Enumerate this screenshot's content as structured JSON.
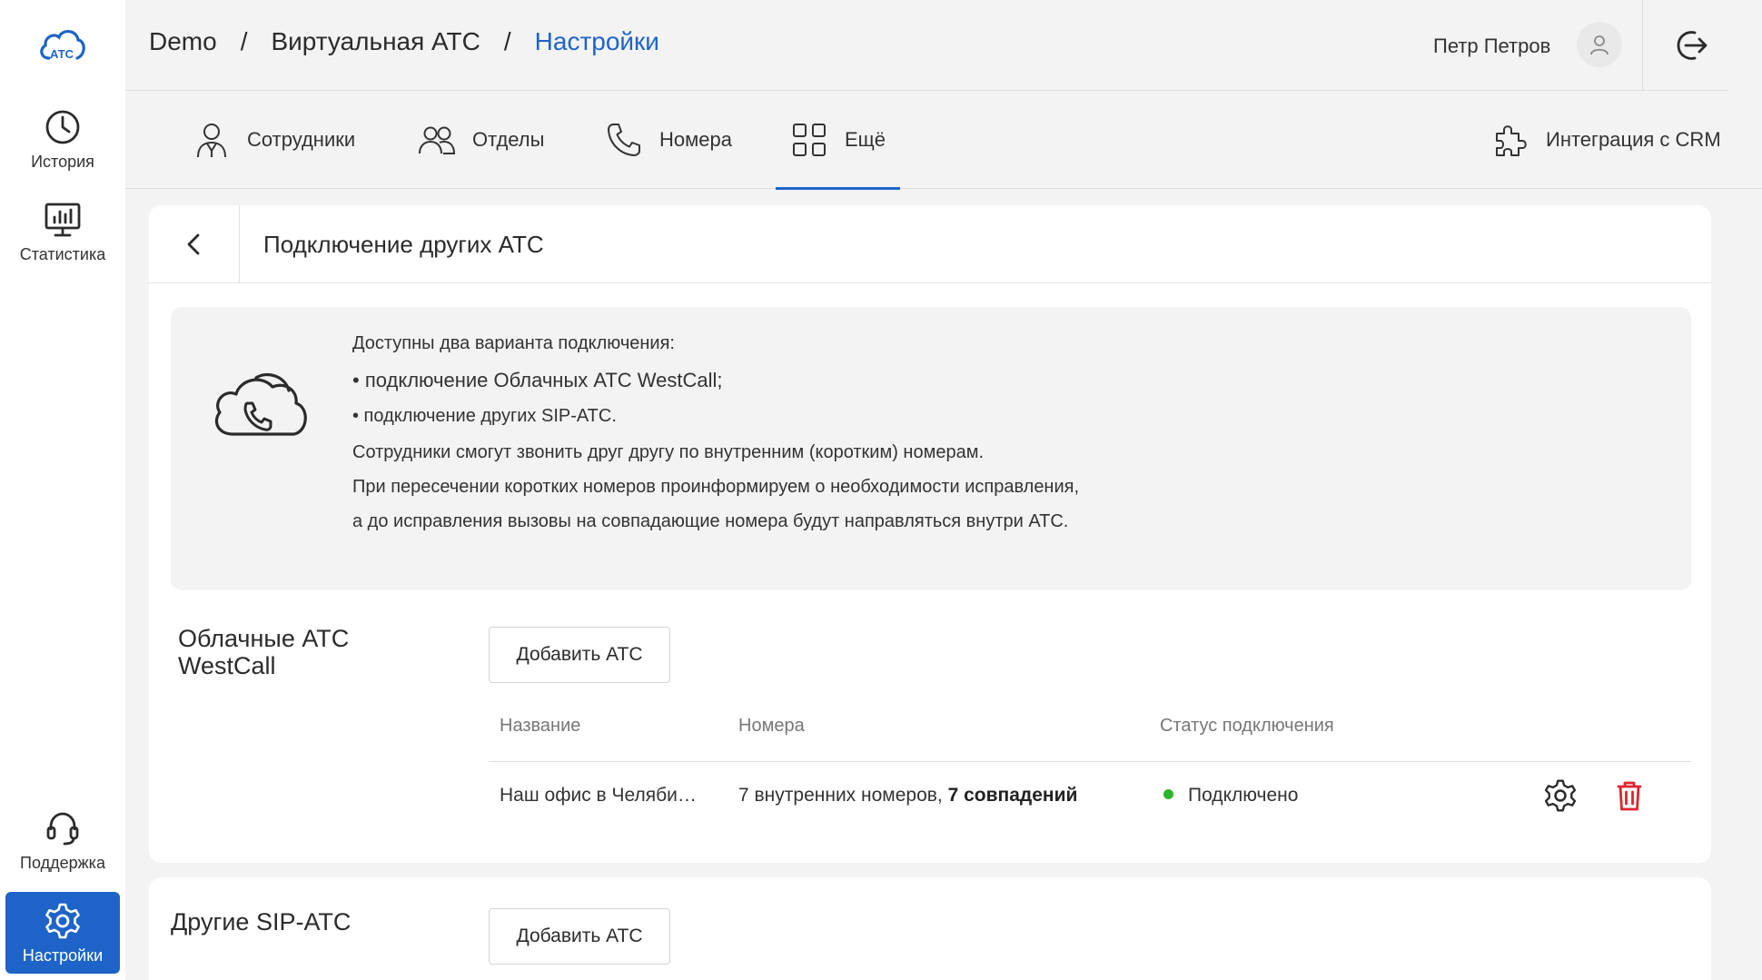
{
  "sidebar": {
    "logo_text": "АТС",
    "items": [
      {
        "label": "История",
        "icon": "clock-icon"
      },
      {
        "label": "Статистика",
        "icon": "monitor-chart-icon"
      },
      {
        "label": "Поддержка",
        "icon": "headset-icon"
      },
      {
        "label": "Настройки",
        "icon": "gear-icon",
        "active": true
      }
    ]
  },
  "header": {
    "breadcrumb": [
      "Demo",
      "Виртуальная АТС",
      "Настройки"
    ],
    "separator": "/",
    "user_name": "Петр Петров"
  },
  "tabs": [
    {
      "label": "Сотрудники",
      "icon": "person-icon"
    },
    {
      "label": "Отделы",
      "icon": "group-icon"
    },
    {
      "label": "Номера",
      "icon": "phone-icon"
    },
    {
      "label": "Ещё",
      "icon": "grid-icon",
      "active": true
    },
    {
      "label": "Интеграция с CRM",
      "icon": "puzzle-icon"
    }
  ],
  "page": {
    "title": "Подключение других АТС",
    "info": {
      "lines": [
        "Доступны два варианта подключения:",
        "• подключение Облачных АТС WestCall;",
        "• подключение других SIP-АТС.",
        "Сотрудники смогут звонить друг другу по внутренним (коротким) номерам.",
        "При пересечении коротких номеров проинформируем о необходимости исправления,",
        "а до исправления вызовы на совпадающие номера будут направляться внутри АТС."
      ]
    },
    "cloud_section": {
      "title_line1": "Облачные АТС",
      "title_line2": "WestCall",
      "add_button": "Добавить АТС",
      "columns": [
        "Название",
        "Номера",
        "Статус подключения"
      ],
      "rows": [
        {
          "name": "Наш офис в Челяби…",
          "numbers": "7 внутренних номеров, ",
          "matches": "7 совпадений",
          "status": "Подключено"
        }
      ]
    },
    "sip_section": {
      "title": "Другие SIP-АТС",
      "add_button": "Добавить АТС"
    }
  },
  "colors": {
    "accent": "#1e64c8",
    "status_ok": "#2bb52b",
    "danger": "#e0242f",
    "background": "#f2f3f2"
  }
}
